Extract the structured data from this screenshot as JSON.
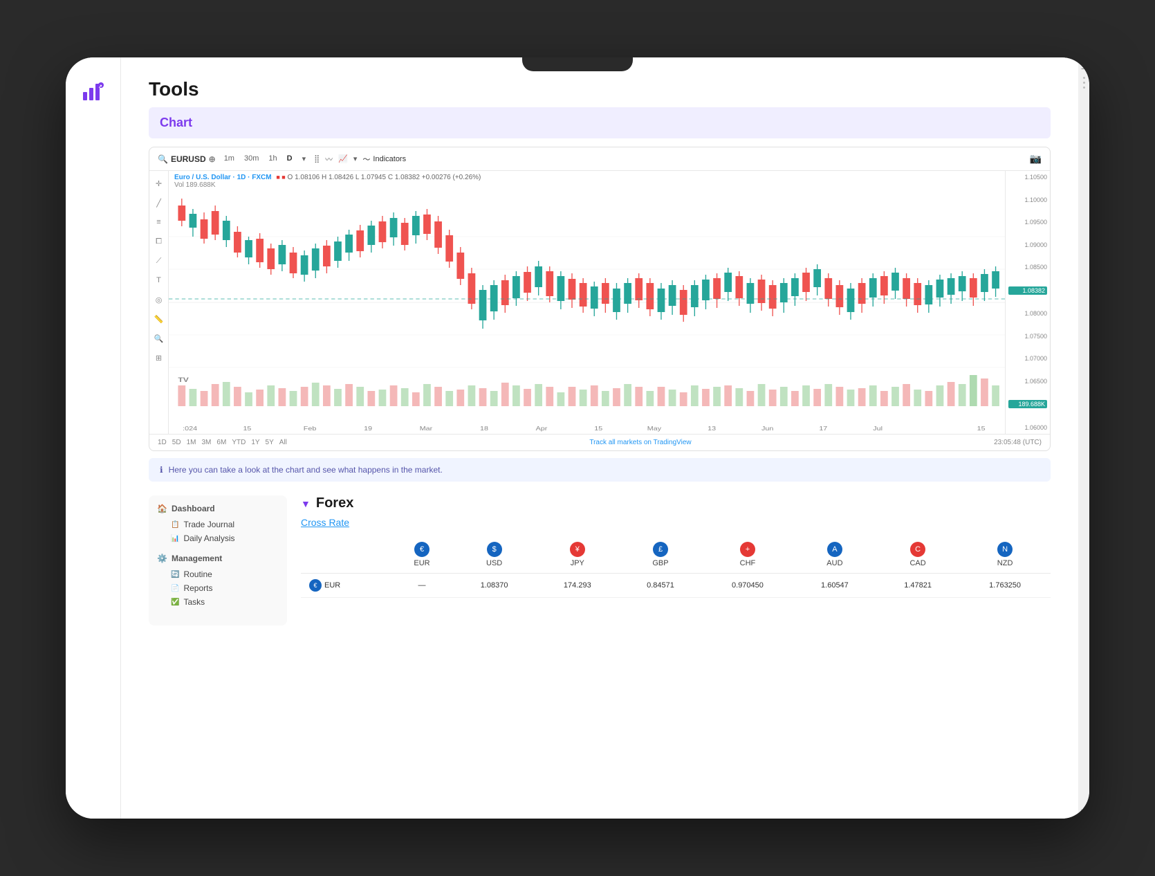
{
  "app": {
    "title": "Tools"
  },
  "chart": {
    "title": "Chart",
    "symbol": "EURUSD",
    "timeframes": [
      "1m",
      "30m",
      "1h",
      "D"
    ],
    "active_timeframe": "D",
    "pair_full": "Euro / U.S. Dollar · 1D · FXCM",
    "ohlc": "O 1.08106  H 1.08426  L 1.07945  C 1.08382  +0.00276  (+0.26%)",
    "volume": "Vol 189.688K",
    "indicators_label": "Indicators",
    "price_levels": [
      "1.10500",
      "1.10000",
      "1.09500",
      "1.09000",
      "1.08500",
      "1.08382",
      "1.08000",
      "1.07500",
      "1.07000",
      "1.06500",
      "1.06000"
    ],
    "current_price": "1.08382",
    "volume_label": "189.688K",
    "time_label": "23:05:48 (UTC)",
    "tradingview_link": "Track all markets on TradingView",
    "footer_timeframes": [
      "1D",
      "5D",
      "1M",
      "3M",
      "6M",
      "YTD",
      "1Y",
      "5Y",
      "All"
    ],
    "date_labels": [
      ":024",
      "15",
      "Feb",
      "19",
      "Mar",
      "18",
      "Apr",
      "15",
      "May",
      "13",
      "Jun",
      "17",
      "Jul",
      "15"
    ]
  },
  "info_message": "Here you can take a look at the chart and see what happens in the market.",
  "sidebar": {
    "groups": [
      {
        "title": "Dashboard",
        "icon": "🏠",
        "items": [
          {
            "label": "Trade Journal",
            "icon": "📋"
          },
          {
            "label": "Daily Analysis",
            "icon": "📊"
          }
        ]
      },
      {
        "title": "Management",
        "icon": "⚙️",
        "items": [
          {
            "label": "Routine",
            "icon": "🔄"
          },
          {
            "label": "Reports",
            "icon": "📄"
          },
          {
            "label": "Tasks",
            "icon": "✅"
          }
        ]
      }
    ]
  },
  "forex": {
    "title": "Forex",
    "section_title": "Cross Rate",
    "currencies": [
      "EUR",
      "USD",
      "JPY",
      "GBP",
      "CHF",
      "AUD",
      "CAD",
      "NZD"
    ],
    "flags": [
      "🇪🇺",
      "🇺🇸",
      "🇯🇵",
      "🇬🇧",
      "🇨🇭",
      "🇦🇺",
      "🇨🇦",
      "🇳🇿"
    ],
    "rows": [
      {
        "base": "EUR",
        "flag": "🇪🇺",
        "values": [
          "—",
          "1.08370",
          "174.293",
          "0.84571",
          "0.970450",
          "1.60547",
          "1.47821",
          "1.763250"
        ]
      }
    ]
  }
}
